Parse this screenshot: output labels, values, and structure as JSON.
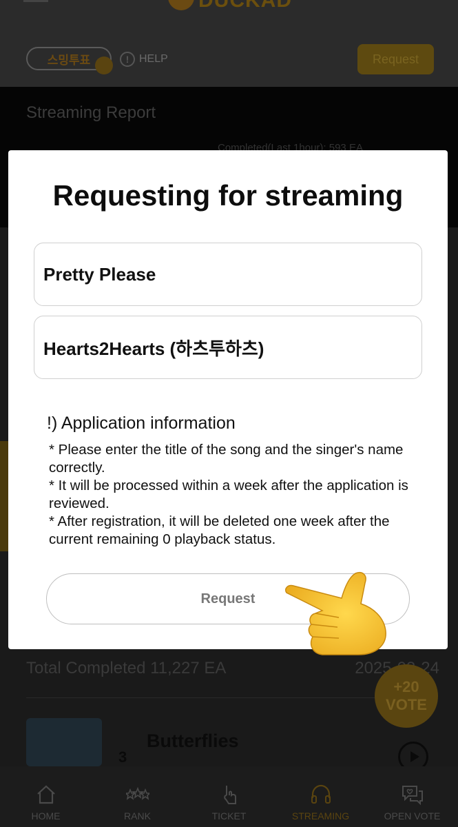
{
  "header": {
    "logo_text": "DUCKAD",
    "vote_pill_label": "스밍투표",
    "help_label": "HELP",
    "request_button": "Request"
  },
  "report": {
    "title": "Streaming Report",
    "subtitle": "Completed(Last 1hour): 593 EA"
  },
  "totals": {
    "total_completed": "Total Completed 11,227 EA",
    "date": "2025-03-24"
  },
  "vote_badge": {
    "line1": "+20",
    "line2": "VOTE"
  },
  "list": {
    "song_title": "Butterflies",
    "rank": "3"
  },
  "bottom_nav": {
    "items": [
      {
        "label": "HOME",
        "icon": "home-icon"
      },
      {
        "label": "RANK",
        "icon": "stars-icon"
      },
      {
        "label": "TICKET",
        "icon": "ticket-icon"
      },
      {
        "label": "STREAMING",
        "icon": "headphones-icon",
        "active": true
      },
      {
        "label": "OPEN VOTE",
        "icon": "chat-heart-icon"
      }
    ]
  },
  "modal": {
    "title": "Requesting for streaming",
    "song_field_value": "Pretty Please",
    "artist_field_value": "Hearts2Hearts (하츠투하츠)",
    "info_title": "!) Application information",
    "info_lines": [
      "* Please enter the title of the song and the singer's name correctly.",
      "* It will be processed within a week after the application is reviewed.",
      "* After registration, it will be deleted one week after the current remaining 0 playback status."
    ],
    "request_button": "Request"
  },
  "colors": {
    "accent": "#f5b800",
    "overlay_bg": "#1a1a1a",
    "modal_bg": "#ffffff",
    "hand_emoji": "#f7c531"
  }
}
